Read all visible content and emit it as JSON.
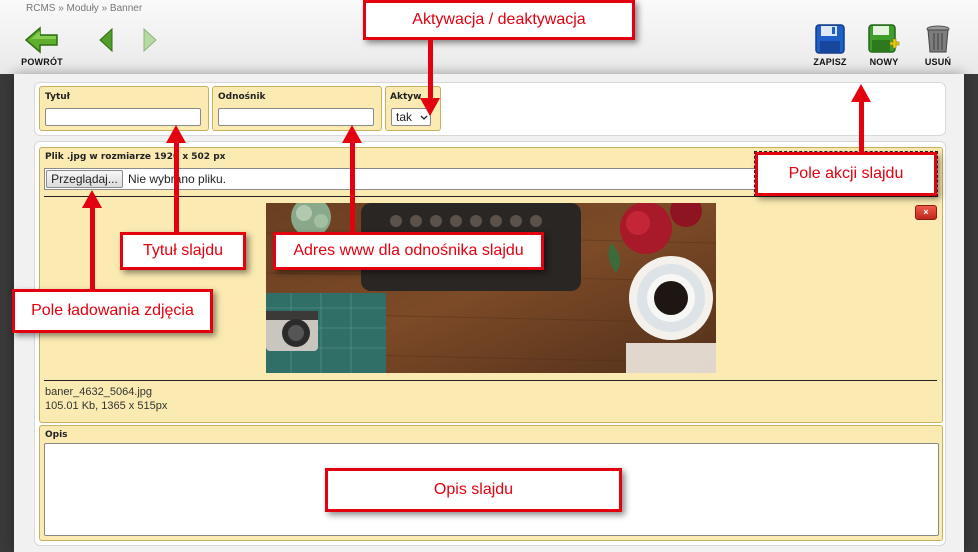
{
  "breadcrumb": "RCMS » Moduły » Banner",
  "toolbar": {
    "back_label": "POWRÓT",
    "save_label": "ZAPISZ",
    "new_label": "NOWY",
    "delete_label": "USUŃ"
  },
  "form": {
    "title_label": "Tytuł",
    "title_value": "",
    "link_label": "Odnośnik",
    "link_value": "",
    "active_label": "Aktyw",
    "active_value": "tak",
    "file_label": "Plik .jpg w rozmiarze 1920 x 502 px",
    "browse_label": "Przeglądaj...",
    "file_status": "Nie wybrano pliku.",
    "delete_icon_label": "×",
    "file_name": "baner_4632_5064.jpg",
    "file_meta": "105.01 Kb, 1365 x 515px",
    "desc_label": "Opis",
    "desc_value": ""
  },
  "annotations": {
    "activation": "Aktywacja / deaktywacja",
    "slide_action": "Pole akcji slajdu",
    "slide_title": "Tytuł slajdu",
    "slide_url": "Adres www dla odnośnika slajdu",
    "upload": "Pole ładowania zdjęcia",
    "description": "Opis slajdu"
  },
  "colors": {
    "panel_bg": "#fbeab1",
    "panel_border": "#c8b060",
    "annotation_red": "#e3000f"
  }
}
